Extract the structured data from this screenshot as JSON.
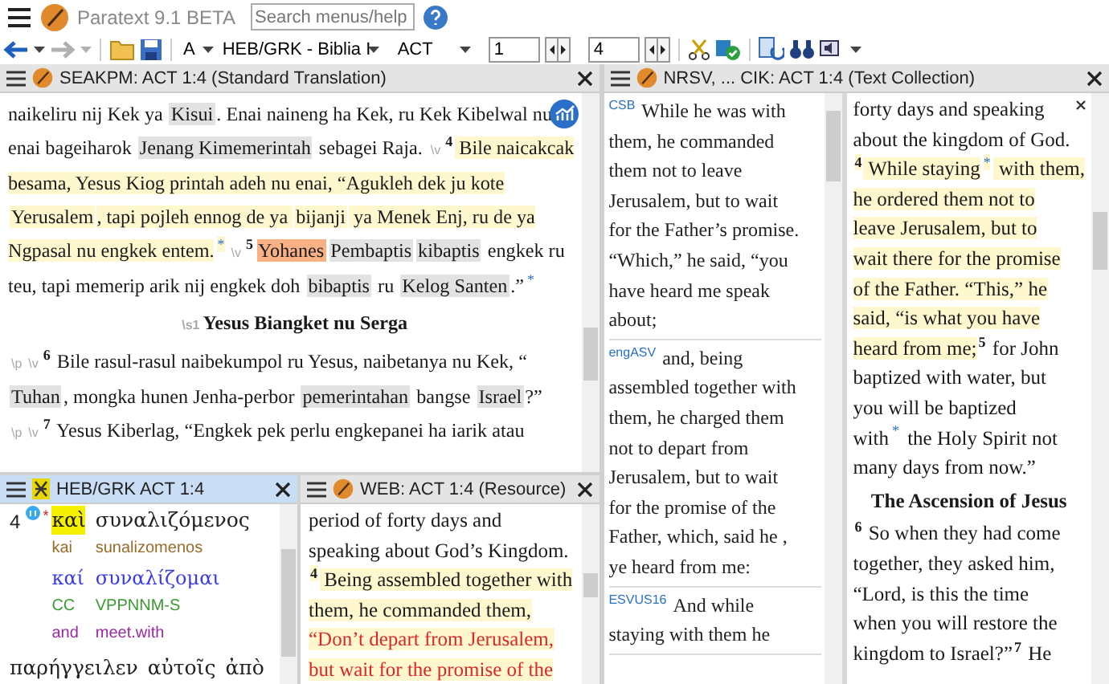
{
  "app": {
    "title": "Paratext 9.1 BETA",
    "search": {
      "placeholder": "Search menus/help"
    }
  },
  "toolbar": {
    "nav": [
      {
        "kind": "back",
        "disabled": false
      },
      {
        "kind": "forward",
        "disabled": true
      }
    ],
    "font": "A",
    "project": "HEB/GRK - Biblia I",
    "book": "ACT",
    "chapter": "1",
    "verse": "4"
  },
  "main": {
    "title": "SEAKPM: ACT 1:4 (Standard Translation)",
    "active": false,
    "lines": [
      {
        "kind": "line",
        "segments": [
          {
            "text": "naikeliru nij Kek ya ",
            "kind": "text",
            "current": false
          },
          {
            "text": "Kisui",
            "kind": "term",
            "current": false
          },
          {
            "text": ". Enai naineng ha Kek, ru Kek Kibelwal nu",
            "kind": "text",
            "current": false
          }
        ]
      },
      {
        "kind": "line",
        "segments": [
          {
            "text": "enai bageiharok ",
            "kind": "text",
            "current": false
          },
          {
            "text": "Jenang Kimemerintah",
            "kind": "term",
            "current": false
          },
          {
            "text": " sebagei Raja. ",
            "kind": "text",
            "current": false
          },
          {
            "text": "\\v",
            "kind": "marker",
            "current": false
          },
          {
            "text": "4",
            "kind": "verse",
            "current": false
          },
          {
            "text": " Bile naicakcak",
            "kind": "text",
            "current": true
          }
        ]
      },
      {
        "kind": "line",
        "segments": [
          {
            "text": "besama, Yesus Kiog printah adeh nu enai, “Agukleh dek ju kote",
            "kind": "text",
            "current": true
          }
        ]
      },
      {
        "kind": "line",
        "segments": [
          {
            "text": "Yerusalem",
            "kind": "term",
            "current": true
          },
          {
            "text": ", tapi pojleh ennog de ya ",
            "kind": "text",
            "current": true
          },
          {
            "text": "bijanji",
            "kind": "term",
            "current": true
          },
          {
            "text": " ya Menek Enj, ru de ya",
            "kind": "text",
            "current": true
          }
        ]
      },
      {
        "kind": "line",
        "segments": [
          {
            "text": "Ngpasal nu engkek entem.",
            "kind": "text",
            "current": true
          },
          {
            "text": "*",
            "kind": "note",
            "current": true
          },
          {
            "text": "\\v",
            "kind": "marker",
            "current": false
          },
          {
            "text": "5",
            "kind": "verse",
            "current": false
          },
          {
            "text": "Yohanes",
            "kind": "found",
            "current": false
          },
          {
            "text": "Pembaptis",
            "kind": "term",
            "current": false
          },
          {
            "text": "kibaptis",
            "kind": "term",
            "current": false
          },
          {
            "text": " engkek ru",
            "kind": "text",
            "current": false
          }
        ]
      },
      {
        "kind": "line",
        "segments": [
          {
            "text": "teu, tapi memerip arik nij engkek doh ",
            "kind": "text",
            "current": false
          },
          {
            "text": "bibaptis",
            "kind": "term",
            "current": false
          },
          {
            "text": " ru ",
            "kind": "text",
            "current": false
          },
          {
            "text": "Kelog Santen",
            "kind": "term",
            "current": false
          },
          {
            "text": ".”",
            "kind": "text",
            "current": false
          },
          {
            "text": "*",
            "kind": "note",
            "current": false
          }
        ]
      },
      {
        "kind": "heading",
        "segments": [
          {
            "text": "\\s1",
            "kind": "marker",
            "current": false
          },
          {
            "text": "Yesus Biangket nu Serga",
            "kind": "text",
            "current": false
          }
        ]
      },
      {
        "kind": "line",
        "segments": [
          {
            "text": "\\p",
            "kind": "marker",
            "current": false
          },
          {
            "text": "\\v",
            "kind": "marker",
            "current": false
          },
          {
            "text": "6",
            "kind": "verse",
            "current": false
          },
          {
            "text": " Bile rasul-rasul naibekumpol ru Yesus, naibetanya nu Kek, “",
            "kind": "text",
            "current": false
          }
        ]
      },
      {
        "kind": "line",
        "segments": [
          {
            "text": "Tuhan",
            "kind": "term",
            "current": false
          },
          {
            "text": ", mongka hunen Jenha-perbor ",
            "kind": "text",
            "current": false
          },
          {
            "text": "pemerintahan",
            "kind": "term",
            "current": false
          },
          {
            "text": " bangse ",
            "kind": "text",
            "current": false
          },
          {
            "text": "Israel",
            "kind": "term",
            "current": false
          },
          {
            "text": "?”",
            "kind": "text",
            "current": false
          }
        ]
      },
      {
        "kind": "line",
        "segments": [
          {
            "text": "\\p",
            "kind": "marker",
            "current": false
          },
          {
            "text": "\\v",
            "kind": "marker",
            "current": false
          },
          {
            "text": "7",
            "kind": "verse",
            "current": false
          },
          {
            "text": " Yesus Kiberlag, “Engkek pek perlu engkepanei ha iarik atau",
            "kind": "text",
            "current": false
          }
        ]
      }
    ]
  },
  "interlinear": {
    "title": "HEB/GRK ACT 1:4",
    "active": true,
    "verse": "4",
    "note": "*",
    "words": [
      {
        "greek": "καὶ",
        "translit": "kai",
        "lemma": "καί",
        "morph": "CC",
        "gloss": "and",
        "selected": true
      },
      {
        "greek": "συναλιζόμενος",
        "translit": "sunalizomenos",
        "lemma": "συναλίζομαι",
        "morph": "VPPNNM-S",
        "gloss": "meet.with",
        "selected": false
      }
    ],
    "next_words": [
      "παρήγγειλεν",
      "αὐτοῖς",
      "ἀπὸ"
    ]
  },
  "resource": {
    "title": "WEB: ACT 1:4 (Resource)",
    "active": false,
    "lines": [
      {
        "kind": "line",
        "segments": [
          {
            "text": "period of forty days and",
            "kind": "text",
            "current": false
          }
        ]
      },
      {
        "kind": "line",
        "segments": [
          {
            "text": "speaking about God’s Kingdom.",
            "kind": "text",
            "current": false
          }
        ]
      },
      {
        "kind": "line",
        "segments": [
          {
            "text": "4",
            "kind": "verse",
            "current": true
          },
          {
            "text": " Being assembled together with",
            "kind": "text",
            "current": true
          }
        ]
      },
      {
        "kind": "line",
        "segments": [
          {
            "text": "them, he commanded them,",
            "kind": "text",
            "current": true
          }
        ]
      },
      {
        "kind": "line",
        "segments": [
          {
            "text": "“Don’t depart from Jerusalem,",
            "kind": "jesus",
            "current": true
          }
        ]
      },
      {
        "kind": "line",
        "segments": [
          {
            "text": "but wait for the promise of the",
            "kind": "jesus",
            "current": true
          }
        ]
      }
    ]
  },
  "collection": {
    "title": "NRSV, ... CIK: ACT 1:4 (Text Collection)",
    "active": false,
    "entries": [
      {
        "source": "CSB",
        "lines": [
          "While he was with",
          "them, he commanded",
          "them not to leave",
          "Jerusalem, but to wait",
          "for the Father’s promise.",
          "“Which,” he said, “you",
          "have heard me speak",
          "about;"
        ]
      },
      {
        "source": "engASV",
        "lines": [
          "and, being",
          "assembled together with",
          "them, he charged them",
          "not to depart from",
          "Jerusalem, but to wait",
          "for the promise of the",
          "Father, which, said he ,",
          "ye heard from me:"
        ]
      },
      {
        "source": "ESVUS16",
        "lines": [
          "And while",
          "staying with them he"
        ]
      }
    ],
    "lines": [
      {
        "kind": "line",
        "segments": [
          {
            "text": "forty days and speaking",
            "kind": "text",
            "current": false
          }
        ]
      },
      {
        "kind": "line",
        "segments": [
          {
            "text": "about the kingdom of God.",
            "kind": "text",
            "current": false
          }
        ]
      },
      {
        "kind": "line",
        "segments": [
          {
            "text": "4",
            "kind": "verse",
            "current": true
          },
          {
            "text": " While staying",
            "kind": "text",
            "current": true
          },
          {
            "text": "*",
            "kind": "note",
            "current": true
          },
          {
            "text": " with them,",
            "kind": "text",
            "current": true
          }
        ]
      },
      {
        "kind": "line",
        "segments": [
          {
            "text": "he ordered them not to",
            "kind": "text",
            "current": true
          }
        ]
      },
      {
        "kind": "line",
        "segments": [
          {
            "text": "leave Jerusalem, but to",
            "kind": "text",
            "current": true
          }
        ]
      },
      {
        "kind": "line",
        "segments": [
          {
            "text": "wait there for the promise",
            "kind": "text",
            "current": true
          }
        ]
      },
      {
        "kind": "line",
        "segments": [
          {
            "text": "of the Father. “This,” he",
            "kind": "text",
            "current": true
          }
        ]
      },
      {
        "kind": "line",
        "segments": [
          {
            "text": "said, “is what you have",
            "kind": "text",
            "current": true
          }
        ]
      },
      {
        "kind": "line",
        "segments": [
          {
            "text": "heard from me;",
            "kind": "text",
            "current": true
          },
          {
            "text": "5",
            "kind": "verse",
            "current": false
          },
          {
            "text": " for John",
            "kind": "text",
            "current": false
          }
        ]
      },
      {
        "kind": "line",
        "segments": [
          {
            "text": "baptized with water, but",
            "kind": "text",
            "current": false
          }
        ]
      },
      {
        "kind": "line",
        "segments": [
          {
            "text": "you will be baptized",
            "kind": "text",
            "current": false
          }
        ]
      },
      {
        "kind": "line",
        "segments": [
          {
            "text": "with",
            "kind": "text",
            "current": false
          },
          {
            "text": "*",
            "kind": "note",
            "current": false
          },
          {
            "text": " the Holy Spirit not",
            "kind": "text",
            "current": false
          }
        ]
      },
      {
        "kind": "line",
        "segments": [
          {
            "text": "many days from now.”",
            "kind": "text",
            "current": false
          }
        ]
      },
      {
        "kind": "heading",
        "segments": [
          {
            "text": "The Ascension of Jesus",
            "kind": "text",
            "current": false
          }
        ]
      },
      {
        "kind": "line",
        "segments": [
          {
            "text": "6",
            "kind": "verse",
            "current": false
          },
          {
            "text": " So when they had come",
            "kind": "text",
            "current": false
          }
        ]
      },
      {
        "kind": "line",
        "segments": [
          {
            "text": "together, they asked him,",
            "kind": "text",
            "current": false
          }
        ]
      },
      {
        "kind": "line",
        "segments": [
          {
            "text": "“Lord, is this the time",
            "kind": "text",
            "current": false
          }
        ]
      },
      {
        "kind": "line",
        "segments": [
          {
            "text": "when you will restore the",
            "kind": "text",
            "current": false
          }
        ]
      },
      {
        "kind": "line",
        "segments": [
          {
            "text": "kingdom to Israel?”",
            "kind": "text",
            "current": false
          },
          {
            "text": "7",
            "kind": "verse",
            "current": false
          },
          {
            "text": " He",
            "kind": "text",
            "current": false
          }
        ]
      }
    ]
  }
}
